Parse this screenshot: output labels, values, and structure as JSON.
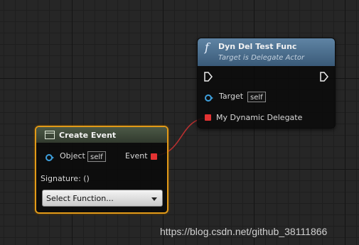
{
  "function_node": {
    "title": "Dyn Del Test Func",
    "subtitle": "Target is Delegate Actor",
    "icon": "f",
    "target_label": "Target",
    "target_default": "self",
    "delegate_label": "My Dynamic Delegate"
  },
  "create_event_node": {
    "title": "Create Event",
    "object_label": "Object",
    "object_default": "self",
    "event_label": "Event",
    "signature_text": "Signature: ()",
    "select_function_label": "Select Function..."
  },
  "watermark": "https://blog.csdn.net/github_38111866",
  "colors": {
    "function_header": "#4d7090",
    "event_header": "#3c4738",
    "selection_outline": "#e29a18",
    "object_pin": "#3ea0dd",
    "delegate_pin": "#e33232",
    "wire": "#b83030"
  }
}
